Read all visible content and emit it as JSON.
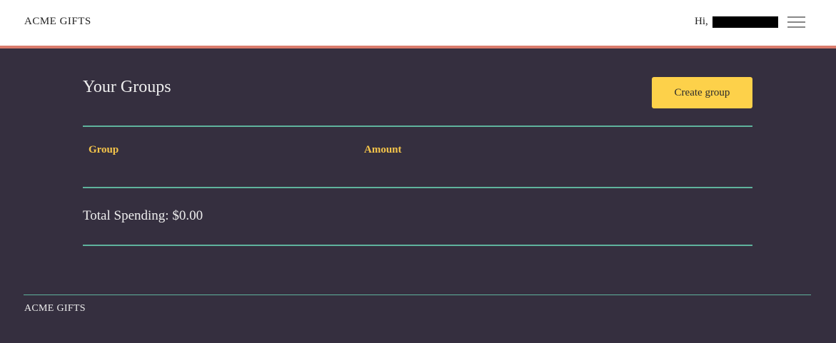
{
  "header": {
    "brand": "ACME GIFTS",
    "greeting_prefix": "Hi,",
    "menu_icon": "hamburger-menu-icon"
  },
  "main": {
    "title": "Your Groups",
    "create_button_label": "Create group",
    "table": {
      "columns": [
        "Group",
        "Amount"
      ],
      "rows": []
    },
    "total_spending": "Total Spending: $0.00"
  },
  "footer": {
    "brand": "ACME GIFTS"
  },
  "colors": {
    "accent_border": "#d97b6c",
    "rule": "#5fb39d",
    "button": "#fdd14a",
    "column_header": "#f4c44a",
    "background": "#352f3f"
  }
}
